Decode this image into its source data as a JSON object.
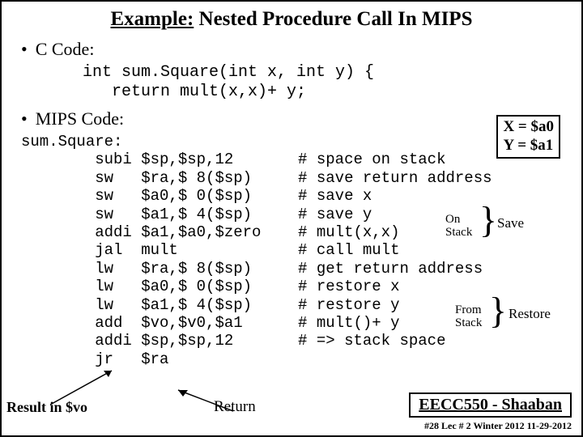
{
  "title_prefix": "Example:",
  "title_rest": "  Nested Procedure Call In MIPS",
  "c_heading": "C Code:",
  "c_code": "int sum.Square(int x, int y) {\n   return mult(x,x)+ y;",
  "mips_heading": "MIPS Code:",
  "regbox": {
    "x": "X = $a0",
    "y": "Y = $a1"
  },
  "mips_code": "sum.Square:\n        subi $sp,$sp,12       # space on stack\n        sw   $ra,$ 8($sp)     # save return address\n        sw   $a0,$ 0($sp)     # save x\n        sw   $a1,$ 4($sp)     # save y\n        addi $a1,$a0,$zero    # mult(x,x)\n        jal  mult             # call mult\n        lw   $ra,$ 8($sp)     # get return address\n        lw   $a0,$ 0($sp)     # restore x\n        lw   $a1,$ 4($sp)     # restore y\n        add  $vo,$v0,$a1      # mult()+ y\n        addi $sp,$sp,12       # => stack space\n        jr   $ra",
  "save_label": "Save",
  "restore_label": "Restore",
  "on_stack": "On\nStack",
  "from_stack": "From\nStack",
  "result_label": "Result in $vo",
  "return_label": "Return",
  "course": "EECC550 - Shaaban",
  "footer": "#28  Lec # 2  Winter 2012  11-29-2012"
}
